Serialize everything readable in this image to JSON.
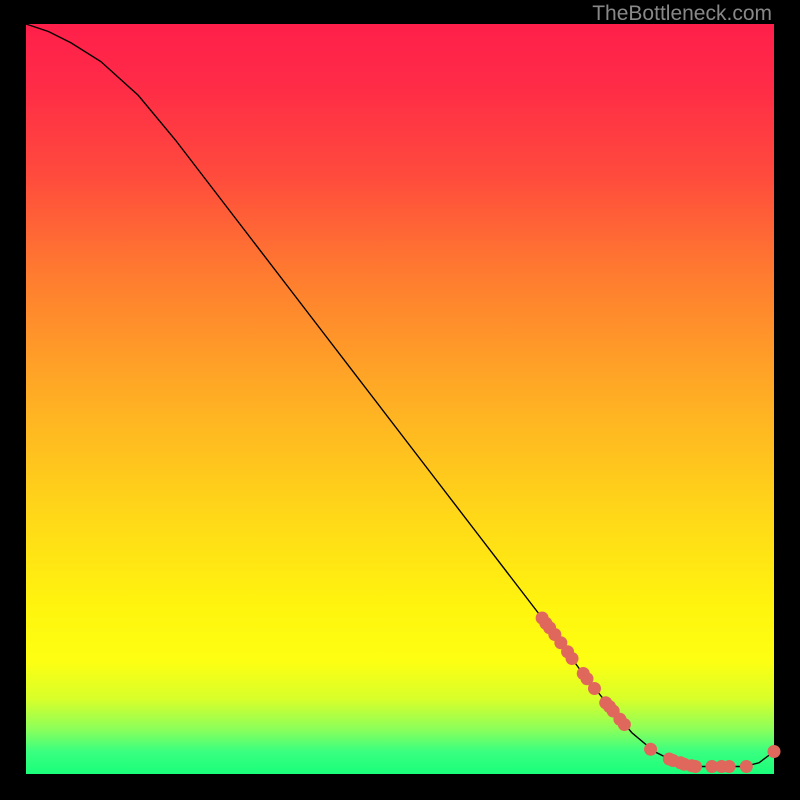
{
  "attribution": "TheBottleneck.com",
  "chart_data": {
    "type": "line",
    "title": "",
    "xlabel": "",
    "ylabel": "",
    "xlim": [
      0,
      100
    ],
    "ylim": [
      0,
      100
    ],
    "series": [
      {
        "name": "curve",
        "x": [
          0,
          3,
          6,
          10,
          15,
          20,
          25,
          30,
          35,
          40,
          45,
          50,
          55,
          60,
          65,
          70,
          74,
          78,
          81,
          84,
          87,
          90,
          93,
          96,
          98,
          100
        ],
        "y": [
          100,
          99,
          97.5,
          95,
          90.5,
          84.5,
          78,
          71.5,
          65,
          58.5,
          52,
          45.5,
          39,
          32.5,
          26,
          19.5,
          14,
          9,
          5.5,
          3,
          1.5,
          1,
          1,
          1,
          1.5,
          3
        ]
      }
    ],
    "markers": [
      {
        "x": 69.0,
        "y": 20.8
      },
      {
        "x": 69.5,
        "y": 20.1
      },
      {
        "x": 70.0,
        "y": 19.5
      },
      {
        "x": 70.7,
        "y": 18.6
      },
      {
        "x": 71.5,
        "y": 17.5
      },
      {
        "x": 72.4,
        "y": 16.3
      },
      {
        "x": 73.0,
        "y": 15.4
      },
      {
        "x": 74.5,
        "y": 13.4
      },
      {
        "x": 75.0,
        "y": 12.7
      },
      {
        "x": 76.0,
        "y": 11.4
      },
      {
        "x": 77.5,
        "y": 9.5
      },
      {
        "x": 78.0,
        "y": 9.0
      },
      {
        "x": 78.5,
        "y": 8.4
      },
      {
        "x": 79.4,
        "y": 7.3
      },
      {
        "x": 80.0,
        "y": 6.6
      },
      {
        "x": 83.5,
        "y": 3.3
      },
      {
        "x": 86.0,
        "y": 2.0
      },
      {
        "x": 86.5,
        "y": 1.8
      },
      {
        "x": 87.5,
        "y": 1.5
      },
      {
        "x": 88.0,
        "y": 1.3
      },
      {
        "x": 89.0,
        "y": 1.1
      },
      {
        "x": 89.5,
        "y": 1.0
      },
      {
        "x": 91.7,
        "y": 1.0
      },
      {
        "x": 93.0,
        "y": 1.0
      },
      {
        "x": 94.0,
        "y": 1.0
      },
      {
        "x": 96.3,
        "y": 1.0
      },
      {
        "x": 100.0,
        "y": 3.0
      }
    ],
    "marker_color": "#e0675c",
    "line_color": "#000000"
  }
}
